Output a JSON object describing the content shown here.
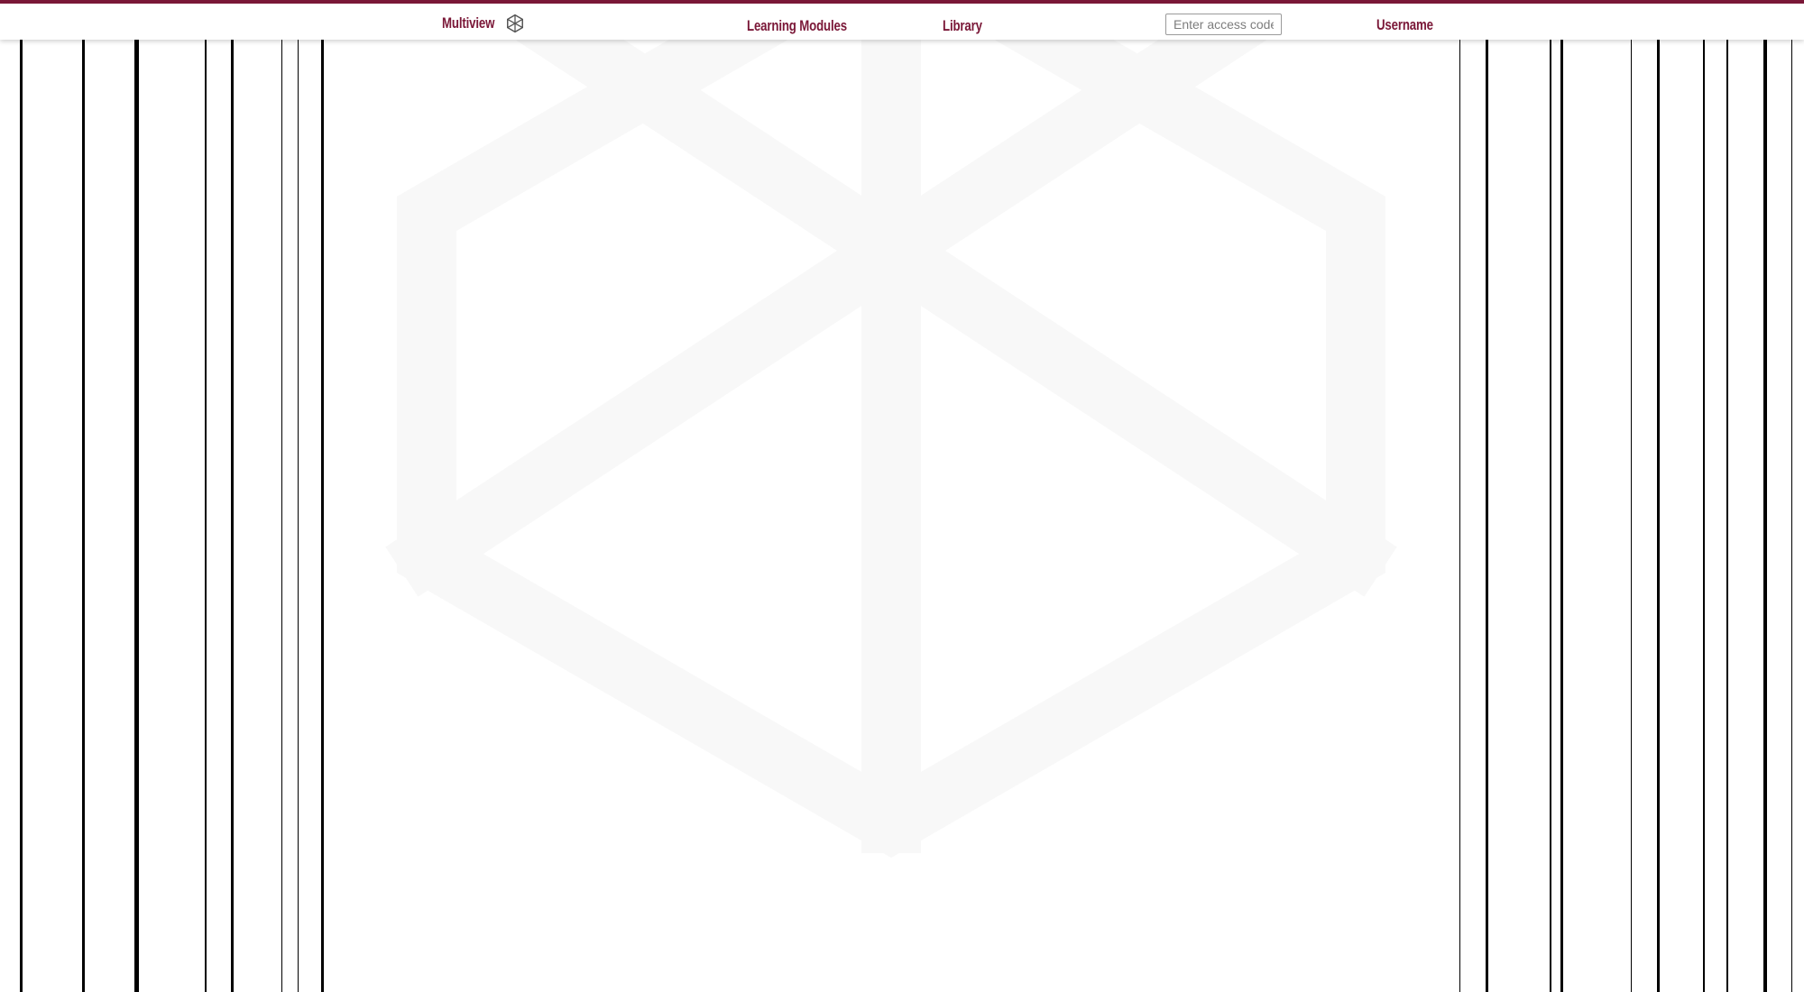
{
  "app": {
    "title": "Multiview",
    "brand_color": "#7a1737",
    "logo_icon": "hexagon-cube-icon"
  },
  "nav": {
    "learning_modules": "Learning Modules",
    "library": "Library"
  },
  "access": {
    "placeholder": "Enter access code",
    "value": ""
  },
  "user": {
    "label": "Username"
  },
  "background": {
    "watermark_icon": "hexagon-cube-watermark-icon",
    "watermark_color": "#f8f8f8",
    "stripe_color": "#000000"
  }
}
